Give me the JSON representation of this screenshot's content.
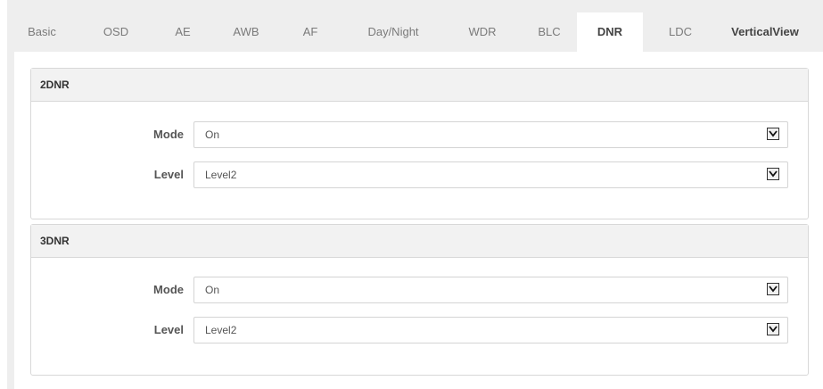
{
  "tabs": [
    {
      "label": "Basic"
    },
    {
      "label": "OSD"
    },
    {
      "label": "AE"
    },
    {
      "label": "AWB"
    },
    {
      "label": "AF"
    },
    {
      "label": "Day/Night"
    },
    {
      "label": "WDR"
    },
    {
      "label": "BLC"
    },
    {
      "label": "DNR",
      "active": true
    },
    {
      "label": "LDC"
    },
    {
      "label": "VerticalView"
    }
  ],
  "panel_2dnr": {
    "title": "2DNR",
    "mode": {
      "label": "Mode",
      "value": "On"
    },
    "level": {
      "label": "Level",
      "value": "Level2"
    }
  },
  "panel_3dnr": {
    "title": "3DNR",
    "mode": {
      "label": "Mode",
      "value": "On"
    },
    "level": {
      "label": "Level",
      "value": "Level2"
    }
  },
  "icons": {
    "dropdown": "chevron-down-icon"
  }
}
